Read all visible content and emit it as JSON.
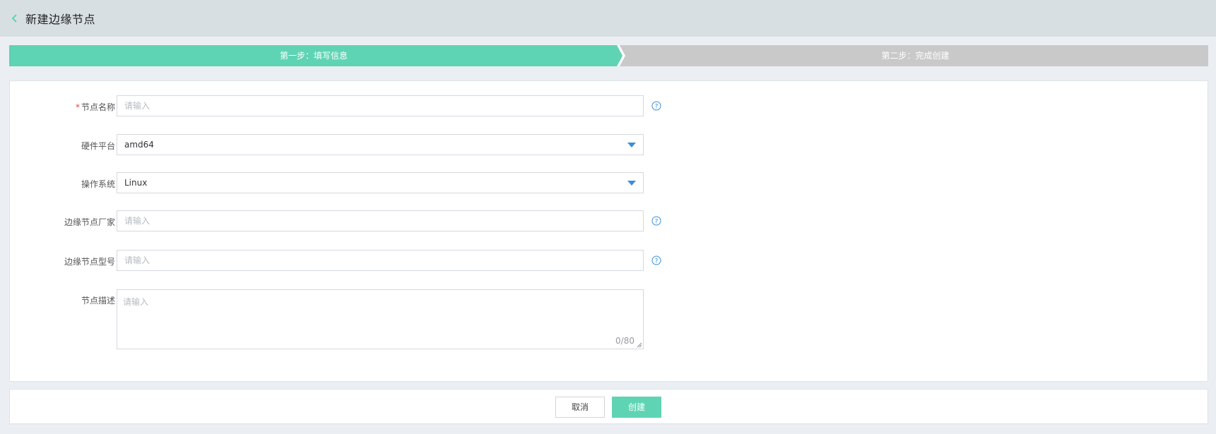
{
  "header": {
    "title": "新建边缘节点",
    "back_icon": "chevron-left-icon"
  },
  "steps": [
    {
      "label": "第一步：填写信息",
      "active": true,
      "color": "#5fd4b4"
    },
    {
      "label": "第二步：完成创建",
      "active": false,
      "color": "#c9c9c9"
    }
  ],
  "form": {
    "node_name": {
      "label": "节点名称",
      "required_mark": "*",
      "placeholder": "请输入"
    },
    "hardware_platform": {
      "label": "硬件平台",
      "value": "amd64"
    },
    "os": {
      "label": "操作系统",
      "value": "Linux"
    },
    "vendor": {
      "label": "边缘节点厂家",
      "placeholder": "请输入"
    },
    "model": {
      "label": "边缘节点型号",
      "placeholder": "请输入"
    },
    "description": {
      "label": "节点描述",
      "placeholder": "请输入",
      "counter": "0/80"
    }
  },
  "footer": {
    "cancel_label": "取消",
    "create_label": "创建"
  },
  "colors": {
    "accent": "#5fd4b4",
    "help_icon": "#3a8fd8",
    "required": "#e64646"
  }
}
